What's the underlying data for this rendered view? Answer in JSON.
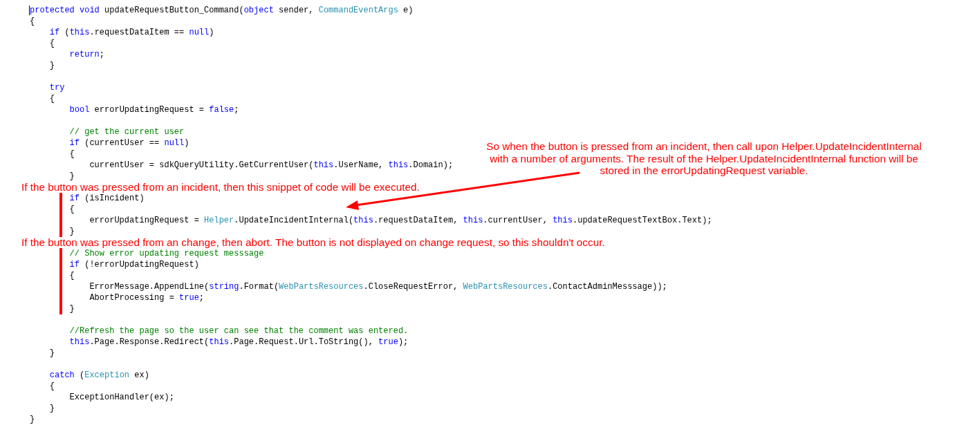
{
  "editor": {
    "caret": true,
    "lines": [
      {
        "kind": "code",
        "marked": false,
        "tokens": [
          {
            "s": "protected void",
            "color": "#0000ff"
          },
          {
            "s": " updateRequestButton_Command("
          },
          {
            "s": "object",
            "color": "#0000ff"
          },
          {
            "s": " sender, "
          },
          {
            "s": "CommandEventArgs",
            "color": "#2b91af"
          },
          {
            "s": " e)"
          }
        ]
      },
      {
        "kind": "code",
        "marked": false,
        "tokens": [
          {
            "s": "{"
          }
        ]
      },
      {
        "kind": "code",
        "marked": false,
        "tokens": [
          {
            "s": "    if",
            "color": "#0000ff"
          },
          {
            "s": " ("
          },
          {
            "s": "this",
            "color": "#0000ff"
          },
          {
            "s": ".requestDataItem == "
          },
          {
            "s": "null",
            "color": "#0000ff"
          },
          {
            "s": ")"
          }
        ]
      },
      {
        "kind": "code",
        "marked": false,
        "tokens": [
          {
            "s": "    {"
          }
        ]
      },
      {
        "kind": "code",
        "marked": false,
        "tokens": [
          {
            "s": "        return",
            "color": "#0000ff"
          },
          {
            "s": ";"
          }
        ]
      },
      {
        "kind": "code",
        "marked": false,
        "tokens": [
          {
            "s": "    }"
          }
        ]
      },
      {
        "kind": "blank"
      },
      {
        "kind": "code",
        "marked": false,
        "tokens": [
          {
            "s": "    try",
            "color": "#0000ff"
          }
        ]
      },
      {
        "kind": "code",
        "marked": false,
        "tokens": [
          {
            "s": "    {"
          }
        ]
      },
      {
        "kind": "code",
        "marked": false,
        "tokens": [
          {
            "s": "        bool",
            "color": "#0000ff"
          },
          {
            "s": " errorUpdatingRequest = "
          },
          {
            "s": "false",
            "color": "#0000ff"
          },
          {
            "s": ";"
          }
        ]
      },
      {
        "kind": "blank"
      },
      {
        "kind": "code",
        "marked": false,
        "tokens": [
          {
            "s": "        // get the current user",
            "color": "#008000"
          }
        ]
      },
      {
        "kind": "code",
        "marked": false,
        "tokens": [
          {
            "s": "        if",
            "color": "#0000ff"
          },
          {
            "s": " (currentUser == "
          },
          {
            "s": "null",
            "color": "#0000ff"
          },
          {
            "s": ")"
          }
        ]
      },
      {
        "kind": "code",
        "marked": false,
        "tokens": [
          {
            "s": "        {"
          }
        ]
      },
      {
        "kind": "code",
        "marked": false,
        "tokens": [
          {
            "s": "            currentUser = sdkQueryUtility.GetCurrentUser("
          },
          {
            "s": "this",
            "color": "#0000ff"
          },
          {
            "s": ".UserName, "
          },
          {
            "s": "this",
            "color": "#0000ff"
          },
          {
            "s": ".Domain);"
          }
        ]
      },
      {
        "kind": "code",
        "marked": false,
        "tokens": [
          {
            "s": "        }"
          }
        ]
      },
      {
        "kind": "note",
        "text": "If the button was pressed from an incident, then this snippet of code will be executed."
      },
      {
        "kind": "code",
        "marked": true,
        "tokens": [
          {
            "s": "        if",
            "color": "#0000ff"
          },
          {
            "s": " (isIncident)"
          }
        ]
      },
      {
        "kind": "code",
        "marked": true,
        "tokens": [
          {
            "s": "        {"
          }
        ]
      },
      {
        "kind": "code",
        "marked": true,
        "tokens": [
          {
            "s": "            errorUpdatingRequest = "
          },
          {
            "s": "Helper",
            "color": "#2b91af"
          },
          {
            "s": ".UpdateIncidentInternal("
          },
          {
            "s": "this",
            "color": "#0000ff"
          },
          {
            "s": ".requestDataItem, "
          },
          {
            "s": "this",
            "color": "#0000ff"
          },
          {
            "s": ".currentUser, "
          },
          {
            "s": "this",
            "color": "#0000ff"
          },
          {
            "s": ".updateRequestTextBox.Text);"
          }
        ]
      },
      {
        "kind": "code",
        "marked": true,
        "tokens": [
          {
            "s": "        }"
          }
        ]
      },
      {
        "kind": "note",
        "text": "If the button was pressed from an change, then abort. The button is not displayed on change request, so this shouldn't occur."
      },
      {
        "kind": "code",
        "marked": true,
        "tokens": [
          {
            "s": "        // Show error updating request messsage",
            "color": "#008000"
          }
        ]
      },
      {
        "kind": "code",
        "marked": true,
        "tokens": [
          {
            "s": "        if",
            "color": "#0000ff"
          },
          {
            "s": " (!errorUpdatingRequest)"
          }
        ]
      },
      {
        "kind": "code",
        "marked": true,
        "tokens": [
          {
            "s": "        {"
          }
        ]
      },
      {
        "kind": "code",
        "marked": true,
        "tokens": [
          {
            "s": "            ErrorMessage.AppendLine("
          },
          {
            "s": "string",
            "color": "#0000ff"
          },
          {
            "s": ".Format("
          },
          {
            "s": "WebPartsResources",
            "color": "#2b91af"
          },
          {
            "s": ".CloseRequestError, "
          },
          {
            "s": "WebPartsResources",
            "color": "#2b91af"
          },
          {
            "s": ".ContactAdminMesssage));"
          }
        ]
      },
      {
        "kind": "code",
        "marked": true,
        "tokens": [
          {
            "s": "            AbortProcessing = "
          },
          {
            "s": "true",
            "color": "#0000ff"
          },
          {
            "s": ";"
          }
        ]
      },
      {
        "kind": "code",
        "marked": true,
        "tokens": [
          {
            "s": "        }"
          }
        ]
      },
      {
        "kind": "blank"
      },
      {
        "kind": "code",
        "marked": false,
        "tokens": [
          {
            "s": "        //Refresh the page so the user can see that the comment was entered.",
            "color": "#008000"
          }
        ]
      },
      {
        "kind": "code",
        "marked": false,
        "tokens": [
          {
            "s": "        this",
            "color": "#0000ff"
          },
          {
            "s": ".Page.Response.Redirect("
          },
          {
            "s": "this",
            "color": "#0000ff"
          },
          {
            "s": ".Page.Request.Url.ToString(), "
          },
          {
            "s": "true",
            "color": "#0000ff"
          },
          {
            "s": ");"
          }
        ]
      },
      {
        "kind": "code",
        "marked": false,
        "tokens": [
          {
            "s": "    }"
          }
        ]
      },
      {
        "kind": "blank"
      },
      {
        "kind": "code",
        "marked": false,
        "tokens": [
          {
            "s": "    catch",
            "color": "#0000ff"
          },
          {
            "s": " ("
          },
          {
            "s": "Exception",
            "color": "#2b91af"
          },
          {
            "s": " ex)"
          }
        ]
      },
      {
        "kind": "code",
        "marked": false,
        "tokens": [
          {
            "s": "    {"
          }
        ]
      },
      {
        "kind": "code",
        "marked": false,
        "tokens": [
          {
            "s": "        ExceptionHandler(ex);"
          }
        ]
      },
      {
        "kind": "code",
        "marked": false,
        "tokens": [
          {
            "s": "    }"
          }
        ]
      },
      {
        "kind": "code",
        "marked": false,
        "tokens": [
          {
            "s": "}"
          }
        ]
      }
    ]
  },
  "callout": {
    "text": "So when the button is pressed from an incident, then call upon Helper.UpdateIncidentInternal with a number of arguments. The result of the Helper.UpdateIncidentInternal function will be stored in the errorUpdatingRequest variable."
  }
}
